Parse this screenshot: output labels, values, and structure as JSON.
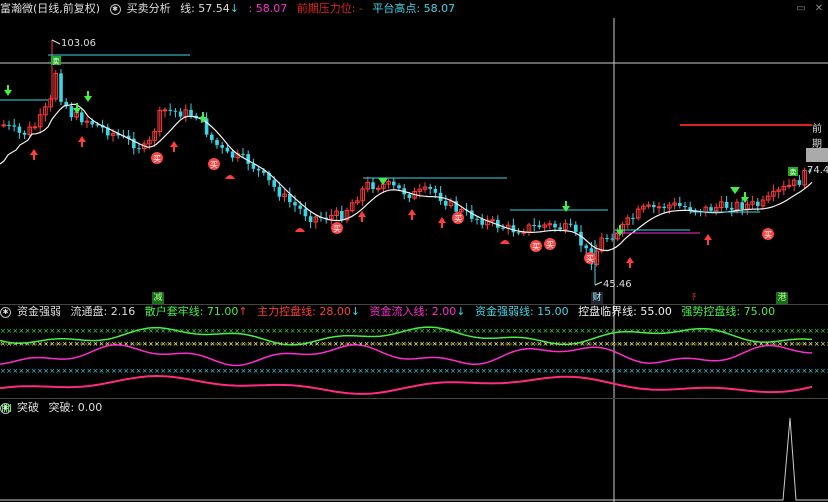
{
  "main_header": {
    "stock_title": "富瀚微(日线,前复权)",
    "indicator_name": "买卖分析",
    "line_label": "线: 57.54",
    "line_arrow": "↓",
    "value2": ": 58.07",
    "pressure_label": "前期压力位: -",
    "platform_label": "平台高点: 58.07"
  },
  "price_labels": {
    "high": "103.06",
    "low": "45.46",
    "right_price": "74.40",
    "right_label": "前期"
  },
  "markers": {
    "jian": "减",
    "cai": "财",
    "niu": "ﾁ",
    "gang": "港",
    "buy": "买",
    "sell": "卖"
  },
  "sub1_header": {
    "name": "资金强弱",
    "float_label": "流通盘: 2.16",
    "retail_label": "散户套牢线: 71.00",
    "retail_arrow": "↑",
    "main_label": "主力控盘线: 28.00",
    "main_arrow": "↓",
    "inflow_label": "资金流入线: 2.00",
    "inflow_arrow": "↓",
    "weak_label": "资金强弱线: 15.00",
    "critical_label": "控盘临界线: 55.00",
    "strong_label": "强势控盘线: 75.00"
  },
  "sub2_header": {
    "name": "突破",
    "value_label": "突破: 0.00"
  },
  "colors": {
    "up": "#ff3b3b",
    "down": "#3ad6e6",
    "ma": "#f0f0f0",
    "platform": "#3ad6e6",
    "pressure": "#e02020",
    "green": "#44ee44",
    "magenta": "#ff2bd0",
    "yellow": "#ffff33",
    "cyan_x": "#3ad6e6",
    "white_x": "#f0f0f0",
    "green_x": "#40e040"
  }
}
